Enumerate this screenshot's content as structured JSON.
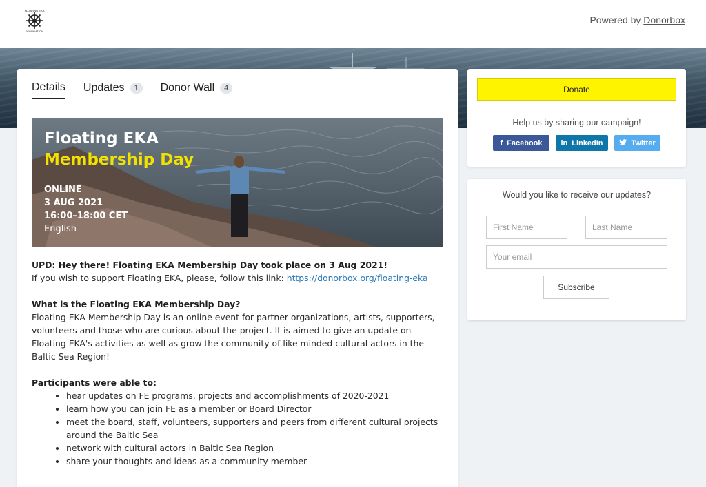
{
  "header": {
    "powered_prefix": "Powered by",
    "powered_link": "Donorbox",
    "logo_text_top": "FLOATING EKA",
    "logo_text_bottom": "FOUNDATION"
  },
  "tabs": [
    {
      "label": "Details",
      "count": null,
      "active": true
    },
    {
      "label": "Updates",
      "count": "1",
      "active": false
    },
    {
      "label": "Donor Wall",
      "count": "4",
      "active": false
    }
  ],
  "hero": {
    "title": "Floating EKA",
    "subtitle": "Membership Day",
    "line1": "ONLINE",
    "line2": "3 AUG  2021",
    "line3": "16:00–18:00 CET",
    "line4": "English"
  },
  "content": {
    "upd_heading": "UPD: Hey there! Floating EKA Membership Day took place on 3 Aug 2021!",
    "support_text": "If you wish to support Floating EKA, please, follow this link:",
    "support_link": "https://donorbox.org/floating-eka",
    "what_heading": "What is the Floating EKA Membership Day?",
    "what_body": "Floating EKA Membership Day is an online event for partner organizations, artists, supporters, volunteers and those who are curious about the project. It is aimed to give an update on Floating EKA's activities as well as grow the community of like minded cultural actors in the Baltic Sea Region!",
    "participants_heading": "Participants were able to:",
    "participants": [
      "hear updates on FE programs, projects and accomplishments of 2020-2021",
      "learn how you can join FE as a member or Board Director",
      "meet the board, staff, volunteers, supporters and peers from different cultural projects around the Baltic Sea",
      "network with cultural actors in Baltic Sea Region",
      "share your thoughts and ideas as a community member"
    ]
  },
  "donate": {
    "button_label": "Donate",
    "share_text": "Help us by sharing our campaign!",
    "facebook": "Facebook",
    "linkedin": "LinkedIn",
    "twitter": "Twitter"
  },
  "updates_form": {
    "title": "Would you like to receive our updates?",
    "first_name_placeholder": "First Name",
    "last_name_placeholder": "Last Name",
    "email_placeholder": "Your email",
    "subscribe_label": "Subscribe"
  },
  "colors": {
    "donate": "#fff400",
    "facebook": "#3b5998",
    "linkedin": "#0e76a8",
    "twitter": "#55acee",
    "hero_subtitle": "#f3e200"
  }
}
